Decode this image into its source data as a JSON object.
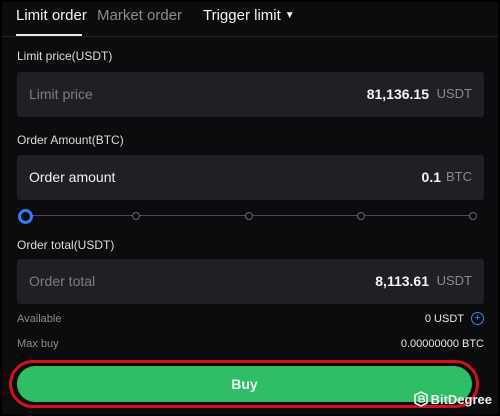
{
  "tabs": {
    "limit": "Limit order",
    "market": "Market order",
    "trigger": "Trigger limit"
  },
  "limit_price": {
    "label": "Limit price(USDT)",
    "placeholder": "Limit price",
    "value": "81,136.15",
    "unit": "USDT"
  },
  "order_amount": {
    "label": "Order Amount(BTC)",
    "placeholder": "Order amount",
    "value": "0.1",
    "unit": "BTC"
  },
  "slider": {
    "level": 0,
    "ticks": 9
  },
  "order_total": {
    "label": "Order total(USDT)",
    "placeholder": "Order total",
    "value": "8,113.61",
    "unit": "USDT"
  },
  "available": {
    "label": "Available",
    "value": "0 USDT"
  },
  "max_buy": {
    "label": "Max buy",
    "value": "0.00000000 BTC"
  },
  "buy_button": "Buy",
  "watermark": "BitDegree",
  "colors": {
    "buy": "#2fbd66",
    "highlight": "#d0121b",
    "accent": "#2f7df6",
    "field_bg": "#1f2026"
  }
}
